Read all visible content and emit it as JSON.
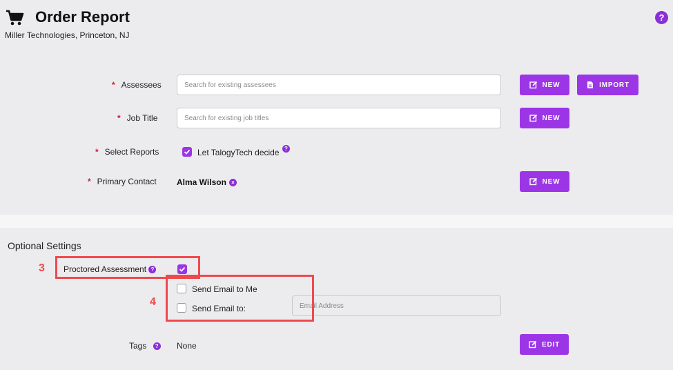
{
  "header": {
    "title": "Order Report",
    "org": "Miller Technologies, Princeton, NJ",
    "cart_icon": "shopping-cart-icon",
    "help_icon": "question-circle-icon",
    "help_glyph": "?"
  },
  "form": {
    "required_mark": "*",
    "assessees": {
      "label": "Assessees",
      "placeholder": "Search for existing assessees",
      "new_label": "NEW",
      "import_label": "IMPORT"
    },
    "job_title": {
      "label": "Job Title",
      "placeholder": "Search for existing job titles",
      "new_label": "NEW"
    },
    "select_reports": {
      "label": "Select Reports",
      "checkbox_label": "Let TalogyTech decide",
      "checked": true
    },
    "primary_contact": {
      "label": "Primary Contact",
      "value": "Alma Wilson",
      "new_label": "NEW"
    }
  },
  "optional": {
    "title": "Optional Settings",
    "proctored": {
      "label": "Proctored Assessment",
      "checked": true
    },
    "send_email_me": {
      "label": "Send Email to Me",
      "checked": false
    },
    "send_email_to": {
      "label": "Send Email to:",
      "checked": false,
      "placeholder": "Email Address"
    },
    "tags": {
      "label": "Tags",
      "value": "None",
      "edit_label": "EDIT"
    }
  },
  "annotations": {
    "step3": "3",
    "step4": "4"
  },
  "colors": {
    "accent": "#9b35e6",
    "required": "#d0182e",
    "callout": "#f0494d",
    "background": "#ececee"
  }
}
